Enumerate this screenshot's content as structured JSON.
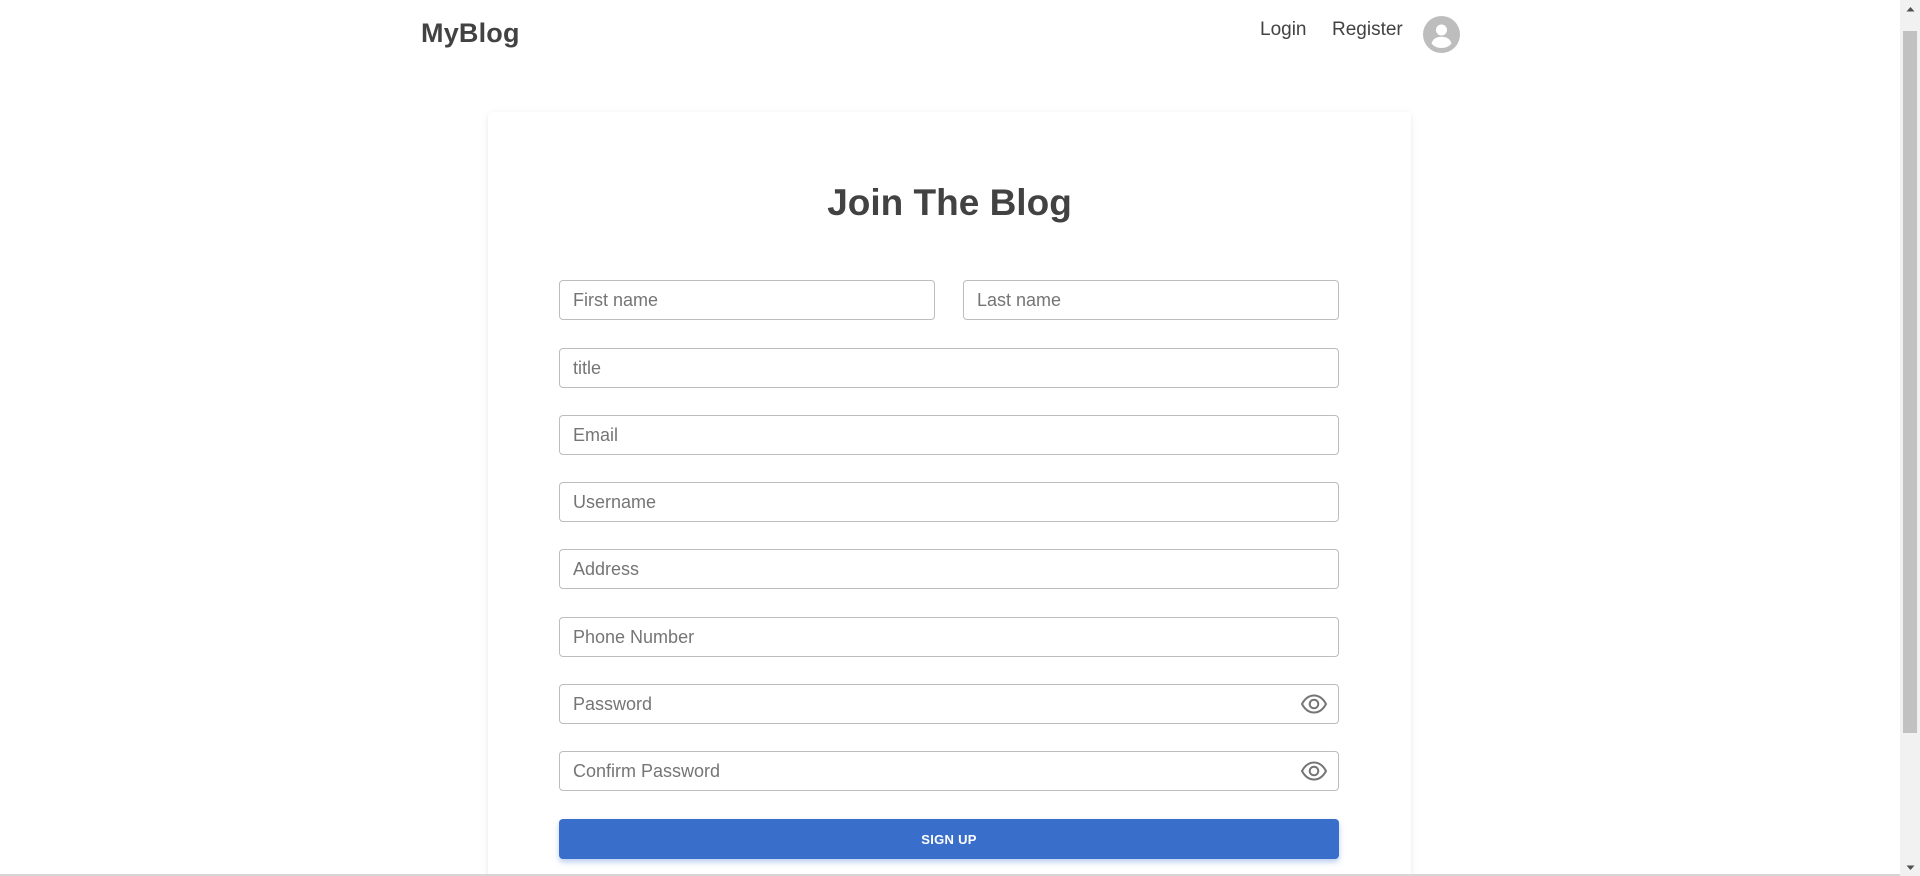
{
  "header": {
    "brand": "MyBlog",
    "nav": {
      "login_label": "Login",
      "register_label": "Register"
    },
    "avatar_icon": "account-circle-icon"
  },
  "form": {
    "title": "Join The Blog",
    "fields": {
      "first_name": {
        "placeholder": "First name",
        "value": ""
      },
      "last_name": {
        "placeholder": "Last name",
        "value": ""
      },
      "title": {
        "placeholder": "title",
        "value": ""
      },
      "email": {
        "placeholder": "Email",
        "value": ""
      },
      "username": {
        "placeholder": "Username",
        "value": ""
      },
      "address": {
        "placeholder": "Address",
        "value": ""
      },
      "phone": {
        "placeholder": "Phone Number",
        "value": ""
      },
      "password": {
        "placeholder": "Password",
        "value": "",
        "toggle_icon": "eye-icon"
      },
      "confirm_password": {
        "placeholder": "Confirm Password",
        "value": "",
        "toggle_icon": "eye-icon"
      }
    },
    "submit_label": "SIGN UP"
  },
  "colors": {
    "primary_button": "#3a6ecb",
    "text": "#424242",
    "border": "#bdbdbd",
    "avatar_bg": "#bdbdbd"
  }
}
